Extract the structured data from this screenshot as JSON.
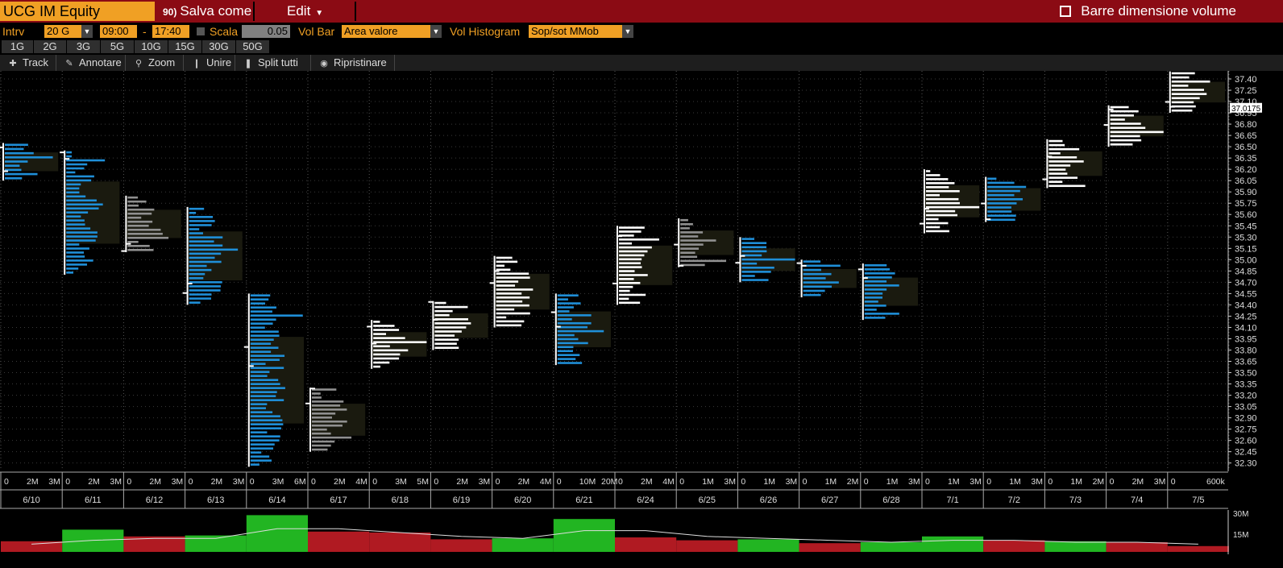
{
  "title_bar": {
    "ticker": "UCG IM Equity",
    "save_num": "90)",
    "save_label": "Salva come",
    "edit_label": "Edit",
    "volume_bars_label": "Barre dimensione volume"
  },
  "settings": {
    "interval_label": "Intrv",
    "interval_value": "20 G",
    "start_time": "09:00",
    "time_sep": "-",
    "end_time": "17:40",
    "scale_label": "Scala",
    "scale_value": "0.05",
    "vol_bar_label": "Vol Bar",
    "vol_bar_value": "Area valore",
    "vol_hist_label": "Vol Histogram",
    "vol_hist_value": "Sop/sot MMob"
  },
  "intervals": [
    "1G",
    "2G",
    "3G",
    "5G",
    "10G",
    "15G",
    "30G",
    "50G"
  ],
  "toolbar": [
    "Track",
    "Annotare",
    "Zoom",
    "Unire",
    "Split tutti",
    "Ripristinare"
  ],
  "colors": {
    "buy": "#1f8fd8",
    "neutral": "#ffffff",
    "gray": "#909090",
    "up": "#22b522",
    "down": "#b01a22"
  },
  "chart_data": {
    "type": "bar",
    "price_axis": [
      "37.40",
      "37.25",
      "37.10",
      "36.95",
      "36.80",
      "36.65",
      "36.50",
      "36.35",
      "36.20",
      "36.05",
      "35.90",
      "35.75",
      "35.60",
      "35.45",
      "35.30",
      "35.15",
      "35.00",
      "34.85",
      "34.70",
      "34.55",
      "34.40",
      "34.25",
      "34.10",
      "33.95",
      "33.80",
      "33.65",
      "33.50",
      "33.35",
      "33.20",
      "33.05",
      "32.90",
      "32.75",
      "32.60",
      "32.45",
      "32.30"
    ],
    "last_price": "37.0175",
    "dates": [
      "6/10",
      "6/11",
      "6/12",
      "6/13",
      "6/14",
      "6/17",
      "6/18",
      "6/19",
      "6/20",
      "6/21",
      "6/24",
      "6/25",
      "6/26",
      "6/27",
      "6/28",
      "7/1",
      "7/2",
      "7/3",
      "7/4",
      "7/5"
    ],
    "day_scale_labels": [
      [
        "0",
        "2M",
        "3M"
      ],
      [
        "0",
        "2M",
        "3M"
      ],
      [
        "0",
        "2M",
        "3M"
      ],
      [
        "0",
        "2M",
        "3M"
      ],
      [
        "0",
        "3M",
        "6M"
      ],
      [
        "0",
        "2M",
        "4M"
      ],
      [
        "0",
        "3M",
        "5M"
      ],
      [
        "0",
        "2M",
        "3M"
      ],
      [
        "0",
        "2M",
        "4M"
      ],
      [
        "0",
        "10M",
        "20M"
      ],
      [
        "0",
        "2M",
        "4M"
      ],
      [
        "0",
        "1M",
        "3M"
      ],
      [
        "0",
        "1M",
        "3M"
      ],
      [
        "0",
        "1M",
        "2M"
      ],
      [
        "0",
        "1M",
        "3M"
      ],
      [
        "0",
        "1M",
        "3M"
      ],
      [
        "0",
        "1M",
        "3M"
      ],
      [
        "0",
        "1M",
        "2M"
      ],
      [
        "0",
        "2M",
        "3M"
      ],
      [
        "0",
        "600k"
      ]
    ],
    "profiles": [
      {
        "low": 36.05,
        "high": 36.55,
        "color": "buy"
      },
      {
        "low": 34.8,
        "high": 36.45,
        "color": "buy"
      },
      {
        "low": 35.1,
        "high": 35.85,
        "color": "gray"
      },
      {
        "low": 34.4,
        "high": 35.7,
        "color": "buy"
      },
      {
        "low": 32.25,
        "high": 34.55,
        "color": "buy"
      },
      {
        "low": 32.45,
        "high": 33.3,
        "color": "gray"
      },
      {
        "low": 33.55,
        "high": 34.2,
        "color": "neutral"
      },
      {
        "low": 33.8,
        "high": 34.45,
        "color": "neutral"
      },
      {
        "low": 34.1,
        "high": 35.05,
        "color": "neutral"
      },
      {
        "low": 33.6,
        "high": 34.55,
        "color": "buy"
      },
      {
        "low": 34.4,
        "high": 35.45,
        "color": "neutral"
      },
      {
        "low": 34.9,
        "high": 35.55,
        "color": "gray"
      },
      {
        "low": 34.7,
        "high": 35.3,
        "color": "buy"
      },
      {
        "low": 34.5,
        "high": 35.0,
        "color": "buy"
      },
      {
        "low": 34.2,
        "high": 34.95,
        "color": "buy"
      },
      {
        "low": 35.35,
        "high": 36.2,
        "color": "neutral"
      },
      {
        "low": 35.5,
        "high": 36.1,
        "color": "buy"
      },
      {
        "low": 35.95,
        "high": 36.6,
        "color": "neutral"
      },
      {
        "low": 36.5,
        "high": 37.05,
        "color": "neutral"
      },
      {
        "low": 36.95,
        "high": 37.5,
        "color": "neutral"
      }
    ],
    "volume_axis": [
      "30M",
      "15M"
    ],
    "daily_volume": [
      {
        "value": 5.5,
        "dir": "down"
      },
      {
        "value": 11.5,
        "dir": "up"
      },
      {
        "value": 8,
        "dir": "down"
      },
      {
        "value": 8.5,
        "dir": "up"
      },
      {
        "value": 19,
        "dir": "up"
      },
      {
        "value": 10.5,
        "dir": "down"
      },
      {
        "value": 10,
        "dir": "down"
      },
      {
        "value": 6.5,
        "dir": "down"
      },
      {
        "value": 7,
        "dir": "up"
      },
      {
        "value": 17,
        "dir": "up"
      },
      {
        "value": 7.5,
        "dir": "down"
      },
      {
        "value": 6,
        "dir": "down"
      },
      {
        "value": 6.5,
        "dir": "up"
      },
      {
        "value": 4.5,
        "dir": "down"
      },
      {
        "value": 5,
        "dir": "up"
      },
      {
        "value": 8,
        "dir": "up"
      },
      {
        "value": 6,
        "dir": "down"
      },
      {
        "value": 5.5,
        "dir": "up"
      },
      {
        "value": 5,
        "dir": "down"
      },
      {
        "value": 3,
        "dir": "down"
      }
    ],
    "volume_avg_line": [
      4,
      6,
      7,
      7,
      12,
      12,
      10,
      8,
      7,
      11,
      11,
      8,
      7,
      6,
      5,
      6,
      6,
      5,
      5,
      4
    ]
  }
}
